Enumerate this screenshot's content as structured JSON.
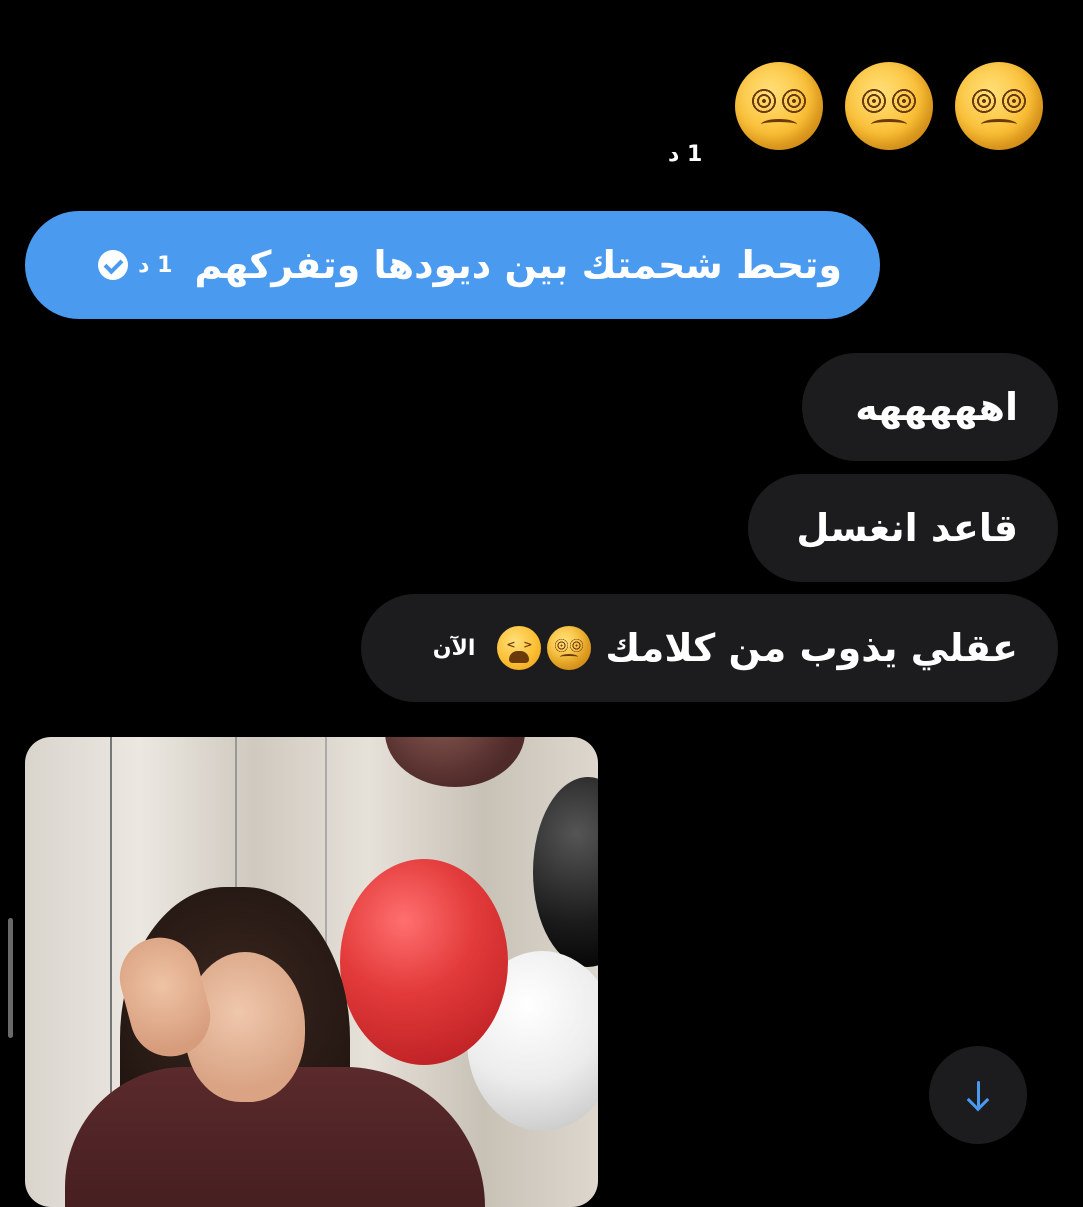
{
  "messages": {
    "top_emoji": [
      "dizzy-face",
      "dizzy-face",
      "dizzy-face"
    ],
    "top_time": "1 د",
    "sent": {
      "text": "وتحط شحمتك بين ديودها وتفركهم",
      "time": "1 د",
      "status": "read"
    },
    "received": [
      {
        "text": "اهههههه"
      },
      {
        "text": "قاعد انغسل"
      },
      {
        "text": "عقلي يذوب من كلامك",
        "emoji": [
          "dizzy-face",
          "tired-face"
        ],
        "time": "الآن"
      }
    ]
  },
  "colors": {
    "sent_bubble": "#4a9af0",
    "received_bubble": "#1c1c1e",
    "background": "#000000"
  },
  "scroll_button": {
    "icon": "arrow-down-icon"
  }
}
